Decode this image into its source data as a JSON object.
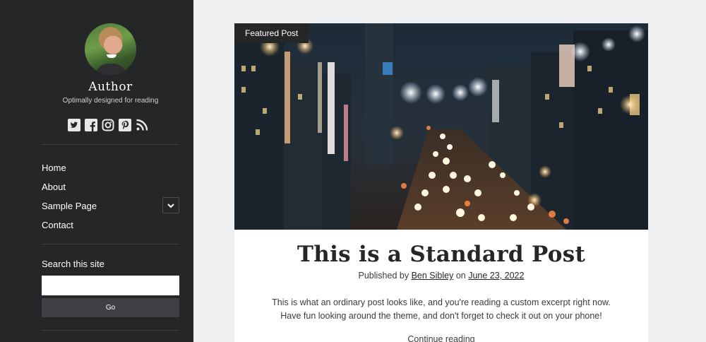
{
  "sidebar": {
    "site_title": "Author",
    "tagline": "Optimally designed for reading",
    "social_icons": [
      "twitter-icon",
      "facebook-icon",
      "instagram-icon",
      "pinterest-icon",
      "rss-icon"
    ],
    "nav": [
      {
        "label": "Home"
      },
      {
        "label": "About"
      },
      {
        "label": "Sample Page",
        "has_submenu": true
      },
      {
        "label": "Contact"
      }
    ],
    "search": {
      "label": "Search this site",
      "value": "",
      "button_label": "Go"
    }
  },
  "post": {
    "badge": "Featured Post",
    "title": "This is a Standard Post",
    "byline_prefix": "Published by",
    "author": "Ben Sibley",
    "byline_on": "on",
    "date": "June 23, 2022",
    "excerpt_line1": "This is what an ordinary post looks like, and you're reading a custom excerpt right now.",
    "excerpt_line2": "Have fun looking around the theme, and don't forget to check it out on your phone!",
    "continue_label": "Continue reading"
  },
  "colors": {
    "sidebar_bg": "#252628",
    "page_bg": "#eff0f2",
    "card_bg": "#ffffff"
  }
}
